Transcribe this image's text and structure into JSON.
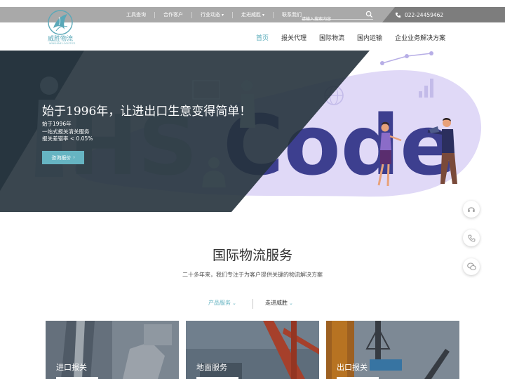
{
  "topbar": {
    "links": [
      {
        "label": "工具查询",
        "has_chevron": false
      },
      {
        "label": "合作客户",
        "has_chevron": false
      },
      {
        "label": "行业动态",
        "has_chevron": true
      },
      {
        "label": "走进威胜",
        "has_chevron": true
      },
      {
        "label": "联系我们",
        "has_chevron": false
      }
    ],
    "search_placeholder": "请输入搜索内容",
    "phone": "022-24459462"
  },
  "logo": {
    "name": "威胜物流",
    "sub": "WINSHINE LOGISTICS"
  },
  "nav": [
    {
      "label": "首页",
      "active": true
    },
    {
      "label": "报关代理",
      "active": false
    },
    {
      "label": "国际物流",
      "active": false
    },
    {
      "label": "国内运输",
      "active": false
    },
    {
      "label": "企业业务解决方案",
      "active": false
    }
  ],
  "hero": {
    "title": "始于1996年，让进出口生意变得简单！",
    "lines": [
      "始于1996年",
      "一站式报关清关服务",
      "报关差错率 < 0.05%"
    ],
    "button": "咨询报价",
    "art_text": "HS Code"
  },
  "section": {
    "title": "国际物流服务",
    "subtitle": "二十多年来，我们专注于为客户提供关键的物流解决方案",
    "tabs": [
      "产品服务",
      "走进威胜"
    ]
  },
  "cards": [
    {
      "label": "进口报关"
    },
    {
      "label": "地面服务"
    },
    {
      "label": "出口报关"
    }
  ],
  "colors": {
    "accent": "#66b4c2",
    "topbar": "#a9a9a9",
    "topbar_dark": "#7d7d7d",
    "hero_dark": "#2c3a44",
    "hero_purple": "#3d3f8f",
    "hero_lavender": "#ddd7f5"
  },
  "side_buttons": [
    "headset-icon",
    "phone-icon",
    "wechat-icon"
  ]
}
